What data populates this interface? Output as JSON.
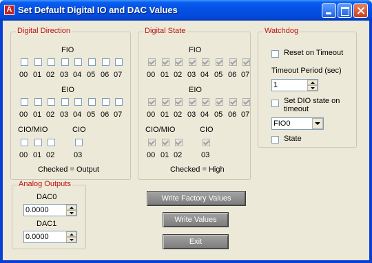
{
  "window": {
    "title": "Set Default Digital IO and DAC Values",
    "icon": "labjack-a-icon"
  },
  "digital_direction": {
    "title": "Digital Direction",
    "fio_label": "FIO",
    "eio_label": "EIO",
    "ciomio_label": "CIO/MIO",
    "cio_label": "CIO",
    "fio": [
      {
        "label": "00",
        "checked": false
      },
      {
        "label": "01",
        "checked": false
      },
      {
        "label": "02",
        "checked": false
      },
      {
        "label": "03",
        "checked": false
      },
      {
        "label": "04",
        "checked": false
      },
      {
        "label": "05",
        "checked": false
      },
      {
        "label": "06",
        "checked": false
      },
      {
        "label": "07",
        "checked": false
      }
    ],
    "eio": [
      {
        "label": "00",
        "checked": false
      },
      {
        "label": "01",
        "checked": false
      },
      {
        "label": "02",
        "checked": false
      },
      {
        "label": "03",
        "checked": false
      },
      {
        "label": "04",
        "checked": false
      },
      {
        "label": "05",
        "checked": false
      },
      {
        "label": "06",
        "checked": false
      },
      {
        "label": "07",
        "checked": false
      }
    ],
    "ciomio": [
      {
        "label": "00",
        "checked": false
      },
      {
        "label": "01",
        "checked": false
      },
      {
        "label": "02",
        "checked": false
      }
    ],
    "cio": [
      {
        "label": "03",
        "checked": false
      }
    ],
    "footer": "Checked = Output"
  },
  "digital_state": {
    "title": "Digital State",
    "fio_label": "FIO",
    "eio_label": "EIO",
    "ciomio_label": "CIO/MIO",
    "cio_label": "CIO",
    "fio": [
      {
        "label": "00",
        "checked": true
      },
      {
        "label": "01",
        "checked": true
      },
      {
        "label": "02",
        "checked": true
      },
      {
        "label": "03",
        "checked": true
      },
      {
        "label": "04",
        "checked": true
      },
      {
        "label": "05",
        "checked": true
      },
      {
        "label": "06",
        "checked": true
      },
      {
        "label": "07",
        "checked": true
      }
    ],
    "eio": [
      {
        "label": "00",
        "checked": true
      },
      {
        "label": "01",
        "checked": true
      },
      {
        "label": "02",
        "checked": true
      },
      {
        "label": "03",
        "checked": true
      },
      {
        "label": "04",
        "checked": true
      },
      {
        "label": "05",
        "checked": true
      },
      {
        "label": "06",
        "checked": true
      },
      {
        "label": "07",
        "checked": true
      }
    ],
    "ciomio": [
      {
        "label": "00",
        "checked": true
      },
      {
        "label": "01",
        "checked": true
      },
      {
        "label": "02",
        "checked": true
      }
    ],
    "cio": [
      {
        "label": "03",
        "checked": true
      }
    ],
    "footer": "Checked = High"
  },
  "watchdog": {
    "title": "Watchdog",
    "reset_label": "Reset on Timeout",
    "timeout_label": "Timeout Period (sec)",
    "timeout_value": "1",
    "set_dio_label_1": "Set DIO state on",
    "set_dio_label_2": "timeout",
    "dio_select": "FIO0",
    "state_label": "State"
  },
  "analog_outputs": {
    "title": "Analog Outputs",
    "dac0_label": "DAC0",
    "dac0_value": "0.0000",
    "dac1_label": "DAC1",
    "dac1_value": "0.0000"
  },
  "buttons": {
    "write_factory": "Write Factory Values",
    "write_values": "Write Values",
    "exit": "Exit"
  }
}
